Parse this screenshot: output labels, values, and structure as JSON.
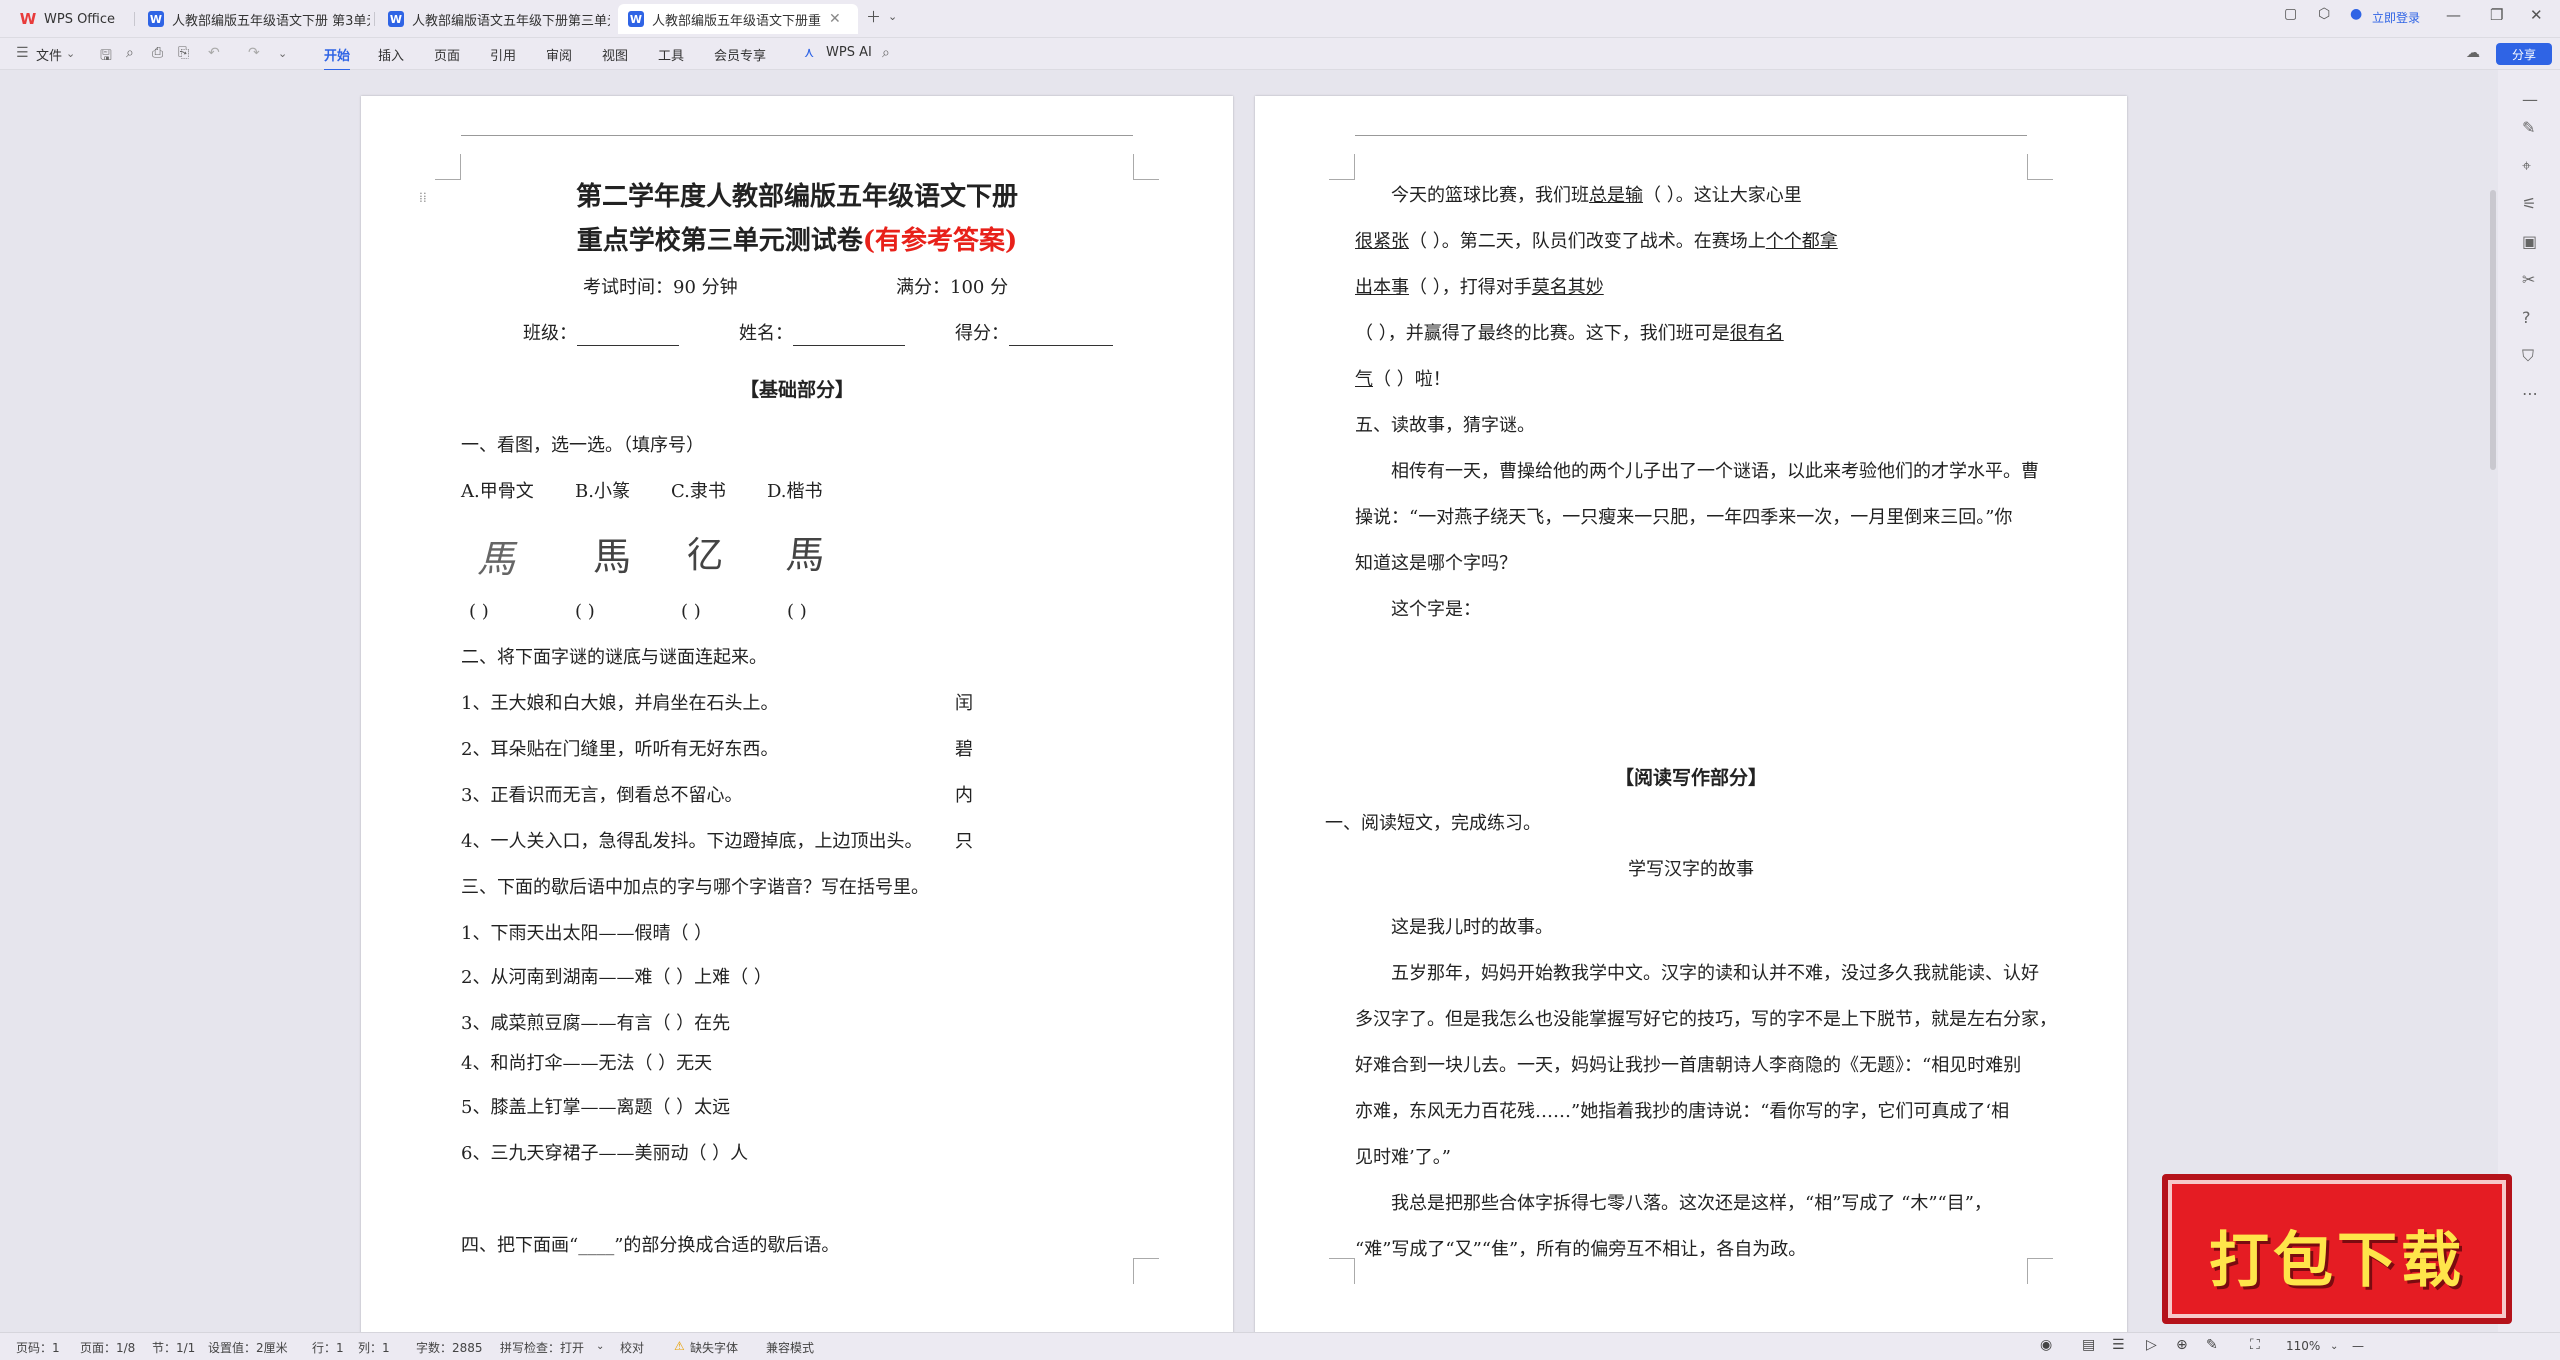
{
  "tabs": [
    {
      "label": "WPS Office",
      "icon": "wps-logo-icon"
    },
    {
      "label": "人教部编版五年级语文下册 第3单元",
      "icon": "word-doc-icon"
    },
    {
      "label": "人教部编版语文五年级下册第三单元",
      "icon": "word-doc-icon"
    },
    {
      "label": "人教部编版五年级语文下册重",
      "icon": "word-doc-icon",
      "active": true
    }
  ],
  "window": {
    "login": "立即登录"
  },
  "menu": {
    "file": "文件",
    "items": [
      "开始",
      "插入",
      "页面",
      "引用",
      "审阅",
      "视图",
      "工具",
      "会员专享"
    ],
    "wps_ai": "WPS AI",
    "share": "分享"
  },
  "page1": {
    "title1": "第二学年度人教部编版五年级语文下册",
    "title2a": "重点学校第三单元测试卷",
    "title2b": "(有参考答案)",
    "time": "考试时间：90 分钟",
    "score": "满分：100 分",
    "cls": "班级：",
    "name": "姓名：",
    "points": "得分：",
    "section": "【基础部分】",
    "q1": "一、看图，选一选。（填序号）",
    "q1_opts": [
      "A.甲骨文",
      "B.小篆",
      "C.隶书",
      "D.楷书"
    ],
    "q1_glyphs": [
      "馬",
      "馬",
      "𢒼",
      "馬"
    ],
    "q1_paren": "(      )",
    "q2": "二、将下面字谜的谜底与谜面连起来。",
    "q2_items": [
      {
        "q": "1、王大娘和白大娘，并肩坐在石头上。",
        "a": "闰"
      },
      {
        "q": "2、耳朵贴在门缝里，听听有无好东西。",
        "a": "碧"
      },
      {
        "q": "3、正看识而无言，倒看总不留心。",
        "a": "内"
      },
      {
        "q": "4、一人关入口，急得乱发抖。下边蹬掉底，上边顶出头。",
        "a": "只"
      }
    ],
    "q3": "三、下面的歇后语中加点的字与哪个字谐音？写在括号里。",
    "q3_items": [
      "1、下雨天出太阳——假晴（       ）",
      "2、从河南到湖南——难（       ）上难（       ）",
      "3、咸菜煎豆腐——有言（       ）在先",
      "4、和尚打伞——无法（       ）无天",
      "5、膝盖上钉掌——离题（       ）太远",
      "6、三九天穿裙子——美丽动（       ）人"
    ],
    "q4": "四、把下面画“____”的部分换成合适的歇后语。"
  },
  "page2": {
    "p1": [
      [
        "今天的篮球比赛，我们班",
        "总是输",
        "（                        ）。这让大家心里"
      ],
      [
        "",
        "很紧张",
        "（                        ）。第二天，队员们改变了战术。在赛场上",
        "个个都拿"
      ],
      [
        "",
        "出本事",
        "（                                  ），打得对手",
        "莫名其妙"
      ],
      [
        "（                        ），并赢得了最终的比赛。这下，我们班可是",
        "很有名"
      ],
      [
        "",
        "气",
        "（                    ）啦！"
      ]
    ],
    "q5": "五、读故事，猜字谜。",
    "story": [
      "相传有一天，曹操给他的两个儿子出了一个谜语，以此来考验他们的才学水平。曹",
      "操说：“一对燕子绕天飞，一只瘦来一只肥，一年四季来一次，一月里倒来三回。”你",
      "知道这是哪个字吗？"
    ],
    "answer": "这个字是：",
    "section": "【阅读写作部分】",
    "r1": "一、阅读短文，完成练习。",
    "rtitle": "学写汉字的故事",
    "para": [
      "这是我儿时的故事。",
      "五岁那年，妈妈开始教我学中文。汉字的读和认并不难，没过多久我就能读、认好",
      "多汉字了。但是我怎么也没能掌握写好它的技巧，写的字不是上下脱节，就是左右分家，",
      "好难合到一块儿去。一天，妈妈让我抄一首唐朝诗人李商隐的《无题》：“相见时难别",
      "亦难，东风无力百花残……”她指着我抄的唐诗说：“看你写的字，它们可真成了‘相",
      "见时难’了。”",
      "我总是把那些合体字拆得七零八落。这次还是这样，“相”写成了 “木”“目”，",
      "“难”写成了“又”“隹”，所有的偏旁互不相让，各自为政。"
    ]
  },
  "status": {
    "page": "页码：1",
    "pages": "页面：1/8",
    "section": "节：1/1",
    "setting": "设置值：2厘米",
    "row": "行：1",
    "col": "列：1",
    "words": "字数：2885",
    "spell": "拼写检查：打开",
    "proof": "校对",
    "missing_font": "缺失字体",
    "compat": "兼容模式",
    "zoom": "110%"
  },
  "promo": {
    "label": "打包下载"
  },
  "colors": {
    "accent": "#2f64e5",
    "title_red": "#e8211a",
    "promo_red": "#e51c23"
  }
}
